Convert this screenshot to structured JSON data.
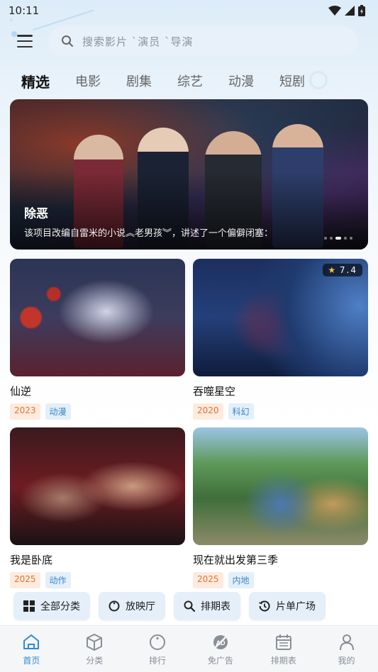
{
  "status": {
    "time": "10:11"
  },
  "search": {
    "placeholder": "搜索影片 ˋ演员 ˋ导演"
  },
  "tabs": [
    {
      "label": "精选",
      "active": true
    },
    {
      "label": "电影"
    },
    {
      "label": "剧集"
    },
    {
      "label": "综艺"
    },
    {
      "label": "动漫"
    },
    {
      "label": "短剧"
    }
  ],
  "banner": {
    "title": "除恶",
    "description": "该项目改编自雷米的小说︽老男孩︾，讲述了一个偏僻闭塞："
  },
  "cards": [
    {
      "title": "仙逆",
      "year": "2023",
      "genre": "动漫"
    },
    {
      "title": "吞噬星空",
      "year": "2020",
      "genre": "科幻",
      "rating": "7.4"
    },
    {
      "title": "我是卧底",
      "year": "2025",
      "genre": "动作"
    },
    {
      "title": "现在就出发第三季",
      "year": "2025",
      "genre": "内地"
    }
  ],
  "quick_links": [
    {
      "label": "全部分类",
      "icon": "grid-icon"
    },
    {
      "label": "放映厅",
      "icon": "circle-icon"
    },
    {
      "label": "排期表",
      "icon": "search-icon"
    },
    {
      "label": "片单广场",
      "icon": "history-icon"
    }
  ],
  "nav": [
    {
      "label": "首页",
      "icon": "home-icon",
      "active": true
    },
    {
      "label": "分类",
      "icon": "cube-icon"
    },
    {
      "label": "排行",
      "icon": "ranking-icon"
    },
    {
      "label": "免广告",
      "icon": "no-ads-icon"
    },
    {
      "label": "排期表",
      "icon": "calendar-icon"
    },
    {
      "label": "我的",
      "icon": "user-icon"
    }
  ],
  "colors": {
    "accent": "#2f8ad8",
    "year_chip": "#e0752f",
    "genre_chip": "#3a86c8",
    "background": "#eaf3fa"
  }
}
